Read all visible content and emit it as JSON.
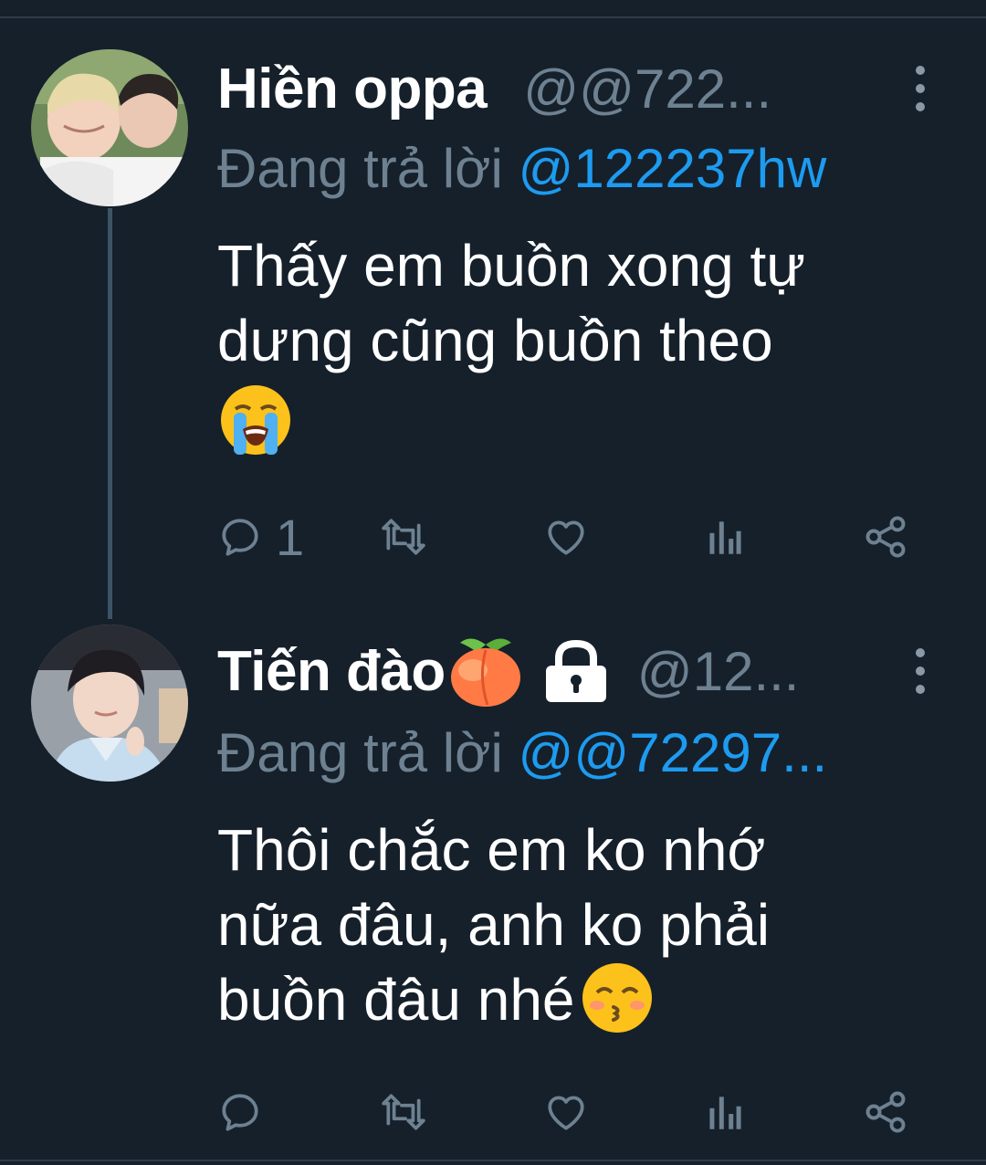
{
  "colors": {
    "background": "#15202b",
    "name_text": "#ffffff",
    "muted_text": "#6e8191",
    "mention": "#1d9bf0",
    "thread_line": "#3d5466"
  },
  "tweets": [
    {
      "display_name": "Hiền oppa",
      "handle": "@@722...",
      "reply_prefix": "Đang trả lời",
      "reply_to": "@122237hw",
      "text_lines": [
        "Thấy em buồn xong tự",
        "dưng cũng buồn theo"
      ],
      "trailing_emoji": "loudly-crying-face",
      "reply_count": "1",
      "icons": [
        "reply-icon",
        "retweet-icon",
        "like-icon",
        "analytics-icon",
        "share-icon",
        "more-icon"
      ]
    },
    {
      "display_name": "Tiến đào",
      "name_emoji": "peach",
      "protected_icon": "lock-icon",
      "handle": "@12...",
      "reply_prefix": "Đang trả lời",
      "reply_to": "@@72297...",
      "text_lines": [
        "Thôi chắc em ko nhớ",
        "nữa đâu, anh ko phải",
        "buồn đâu nhé"
      ],
      "trailing_emoji": "kissing-face-with-smiling-eyes",
      "reply_count": "",
      "icons": [
        "reply-icon",
        "retweet-icon",
        "like-icon",
        "analytics-icon",
        "share-icon",
        "more-icon"
      ]
    }
  ]
}
